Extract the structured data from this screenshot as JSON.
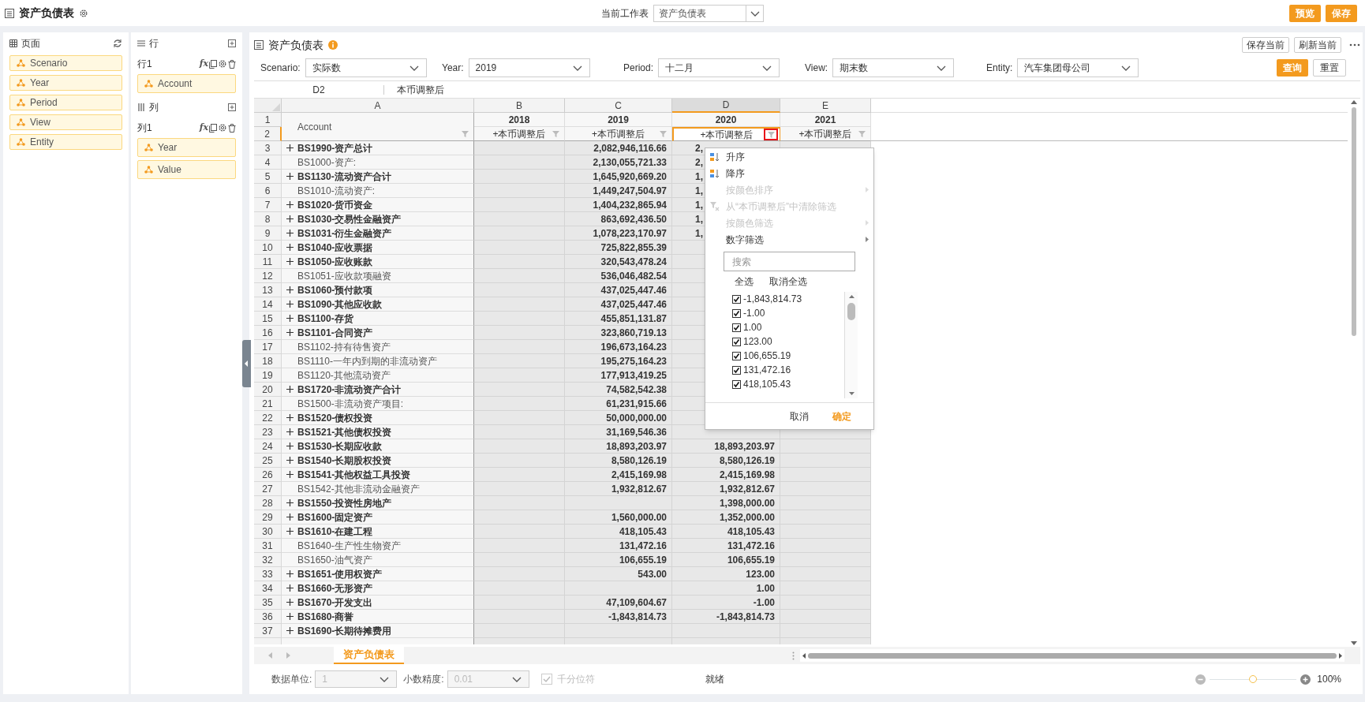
{
  "app_title": "资产负债表",
  "worksheet": {
    "label": "当前工作表",
    "value": "资产负债表"
  },
  "header_buttons": [
    {
      "label": "预览"
    },
    {
      "label": "保存"
    }
  ],
  "page_panel": {
    "title": "页面",
    "items": [
      "Scenario",
      "Year",
      "Period",
      "View",
      "Entity"
    ]
  },
  "rows_panel": {
    "title": "行",
    "group": "行1",
    "formula_glyph": "fx",
    "items": [
      "Account"
    ]
  },
  "columns_panel": {
    "title": "列",
    "group": "列1",
    "formula_glyph": "fx",
    "items": [
      "Year",
      "Value"
    ]
  },
  "report": {
    "title": "资产负债表",
    "actions": [
      "保存当前",
      "刷新当前"
    ]
  },
  "filters": [
    {
      "label": "Scenario:",
      "value": "实际数"
    },
    {
      "label": "Year:",
      "value": "2019"
    },
    {
      "label": "Period:",
      "value": "十二月"
    },
    {
      "label": "View:",
      "value": "期末数"
    },
    {
      "label": "Entity:",
      "value": "汽车集团母公司"
    }
  ],
  "filter_buttons": [
    {
      "label": "查询",
      "primary": true
    },
    {
      "label": "重置",
      "primary": false
    }
  ],
  "formula_bar": {
    "cell": "D2",
    "value": "本币调整后"
  },
  "grid": {
    "columns": [
      {
        "letter": "A",
        "selected": false
      },
      {
        "letter": "B",
        "selected": false
      },
      {
        "letter": "C",
        "selected": false
      },
      {
        "letter": "D",
        "selected": true
      },
      {
        "letter": "E",
        "selected": false
      }
    ],
    "header_numbers": [
      "1",
      "2"
    ],
    "account_header": "Account",
    "years": [
      "2018",
      "2019",
      "2020",
      "2021"
    ],
    "measures": [
      "+本币调整后",
      "+本币调整后",
      "+本币调整后",
      "+本币调整后"
    ],
    "rows": [
      {
        "number": "3",
        "account": "BS1990-资产总计",
        "expandable": true,
        "value_2019": "2,082,946,116.66",
        "value_2020": "2,",
        "value_2020_cut": true
      },
      {
        "number": "4",
        "account": "BS1000-资产:",
        "expandable": false,
        "value_2019": "2,130,055,721.33",
        "value_2020": "2,",
        "value_2020_cut": true
      },
      {
        "number": "5",
        "account": "BS1130-流动资产合计",
        "expandable": true,
        "value_2019": "1,645,920,669.20",
        "value_2020": "1,",
        "value_2020_cut": true
      },
      {
        "number": "6",
        "account": "BS1010-流动资产:",
        "expandable": false,
        "value_2019": "1,449,247,504.97",
        "value_2020": "1,",
        "value_2020_cut": true
      },
      {
        "number": "7",
        "account": "BS1020-货币资金",
        "expandable": true,
        "value_2019": "1,404,232,865.94",
        "value_2020": "1,",
        "value_2020_cut": true
      },
      {
        "number": "8",
        "account": "BS1030-交易性金融资产",
        "expandable": true,
        "value_2019": "863,692,436.50",
        "value_2020": "1,",
        "value_2020_cut": true
      },
      {
        "number": "9",
        "account": "BS1031-衍生金融资产",
        "expandable": true,
        "value_2019": "1,078,223,170.97",
        "value_2020": "1,",
        "value_2020_cut": true
      },
      {
        "number": "10",
        "account": "BS1040-应收票据",
        "expandable": true,
        "value_2019": "725,822,855.39"
      },
      {
        "number": "11",
        "account": "BS1050-应收账款",
        "expandable": true,
        "value_2019": "320,543,478.24"
      },
      {
        "number": "12",
        "account": "BS1051-应收款项融资",
        "expandable": false,
        "value_2019": "536,046,482.54"
      },
      {
        "number": "13",
        "account": "BS1060-预付款项",
        "expandable": true,
        "value_2019": "437,025,447.46"
      },
      {
        "number": "14",
        "account": "BS1090-其他应收款",
        "expandable": true,
        "value_2019": "437,025,447.46"
      },
      {
        "number": "15",
        "account": "BS1100-存货",
        "expandable": true,
        "value_2019": "455,851,131.87"
      },
      {
        "number": "16",
        "account": "BS1101-合同资产",
        "expandable": true,
        "value_2019": "323,860,719.13"
      },
      {
        "number": "17",
        "account": "BS1102-持有待售资产",
        "expandable": false,
        "value_2019": "196,673,164.23"
      },
      {
        "number": "18",
        "account": "BS1110-一年内到期的非流动资产",
        "expandable": false,
        "value_2019": "195,275,164.23"
      },
      {
        "number": "19",
        "account": "BS1120-其他流动资产",
        "expandable": false,
        "value_2019": "177,913,419.25"
      },
      {
        "number": "20",
        "account": "BS1720-非流动资产合计",
        "expandable": true,
        "value_2019": "74,582,542.38"
      },
      {
        "number": "21",
        "account": "BS1500-非流动资产项目:",
        "expandable": false,
        "value_2019": "61,231,915.66"
      },
      {
        "number": "22",
        "account": "BS1520-债权投资",
        "expandable": true,
        "value_2019": "50,000,000.00"
      },
      {
        "number": "23",
        "account": "BS1521-其他债权投资",
        "expandable": true,
        "value_2019": "31,169,546.36"
      },
      {
        "number": "24",
        "account": "BS1530-长期应收款",
        "expandable": true,
        "value_2019": "18,893,203.97",
        "value_2020": "18,893,203.97"
      },
      {
        "number": "25",
        "account": "BS1540-长期股权投资",
        "expandable": true,
        "value_2019": "8,580,126.19",
        "value_2020": "8,580,126.19"
      },
      {
        "number": "26",
        "account": "BS1541-其他权益工具投资",
        "expandable": true,
        "value_2019": "2,415,169.98",
        "value_2020": "2,415,169.98"
      },
      {
        "number": "27",
        "account": "BS1542-其他非流动金融资产",
        "expandable": false,
        "value_2019": "1,932,812.67",
        "value_2020": "1,932,812.67"
      },
      {
        "number": "28",
        "account": "BS1550-投资性房地产",
        "expandable": true,
        "value_2020": "1,398,000.00"
      },
      {
        "number": "29",
        "account": "BS1600-固定资产",
        "expandable": true,
        "value_2019": "1,560,000.00",
        "value_2020": "1,352,000.00"
      },
      {
        "number": "30",
        "account": "BS1610-在建工程",
        "expandable": true,
        "value_2019": "418,105.43",
        "value_2020": "418,105.43"
      },
      {
        "number": "31",
        "account": "BS1640-生产性生物资产",
        "expandable": false,
        "value_2019": "131,472.16",
        "value_2020": "131,472.16"
      },
      {
        "number": "32",
        "account": "BS1650-油气资产",
        "expandable": false,
        "value_2019": "106,655.19",
        "value_2020": "106,655.19"
      },
      {
        "number": "33",
        "account": "BS1651-使用权资产",
        "expandable": true,
        "value_2019": "543.00",
        "value_2020": "123.00"
      },
      {
        "number": "34",
        "account": "BS1660-无形资产",
        "expandable": true,
        "value_2020": "1.00"
      },
      {
        "number": "35",
        "account": "BS1670-开发支出",
        "expandable": true,
        "value_2019": "47,109,604.67",
        "value_2020": "-1.00"
      },
      {
        "number": "36",
        "account": "BS1680-商誉",
        "expandable": true,
        "value_2019": "-1,843,814.73",
        "value_2020": "-1,843,814.73"
      },
      {
        "number": "37",
        "account": "BS1690-长期待摊费用",
        "expandable": true
      }
    ]
  },
  "filter_menu": {
    "items": [
      {
        "kind": "sort_asc",
        "label": "升序",
        "disabled": false,
        "submenu": false
      },
      {
        "kind": "sort_desc",
        "label": "降序",
        "disabled": false,
        "submenu": false
      },
      {
        "kind": "plain",
        "label": "按颜色排序",
        "disabled": true,
        "submenu": true
      },
      {
        "kind": "clear",
        "label": "从“本币调整后”中清除筛选",
        "disabled": true,
        "submenu": false
      },
      {
        "kind": "plain",
        "label": "按颜色筛选",
        "disabled": true,
        "submenu": true
      },
      {
        "kind": "plain",
        "label": "数字筛选",
        "disabled": false,
        "submenu": true
      }
    ],
    "search_placeholder": "搜索",
    "select_all": "全选",
    "clear_all": "取消全选",
    "values": [
      {
        "label": "-1,843,814.73",
        "checked": true
      },
      {
        "label": "-1.00",
        "checked": true
      },
      {
        "label": "1.00",
        "checked": true
      },
      {
        "label": "123.00",
        "checked": true
      },
      {
        "label": "106,655.19",
        "checked": true
      },
      {
        "label": "131,472.16",
        "checked": true
      },
      {
        "label": "418,105.43",
        "checked": true
      }
    ],
    "buttons": [
      {
        "label": "取消",
        "primary": false
      },
      {
        "label": "确定",
        "primary": true
      }
    ]
  },
  "sheet_tabs": [
    {
      "label": "资产负债表",
      "selected": true
    }
  ],
  "status_bar": {
    "unit_label": "数据单位:",
    "unit_value": "1",
    "precision_label": "小数精度:",
    "precision_value": "0.01",
    "disabled": true,
    "thousands": {
      "label": "千分位符",
      "checked": true
    },
    "status": "就绪",
    "zoom": {
      "level": 0.5,
      "reading": "100%"
    }
  }
}
